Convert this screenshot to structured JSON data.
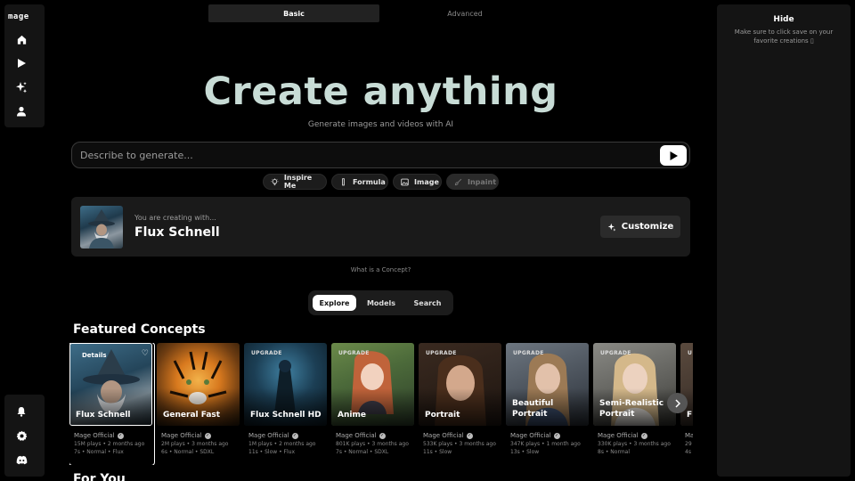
{
  "app": {
    "logo": "mage"
  },
  "nav": {
    "items": [
      {
        "icon": "home-icon"
      },
      {
        "icon": "play-icon"
      },
      {
        "icon": "sparkles-icon"
      },
      {
        "icon": "user-icon"
      }
    ],
    "bottom": [
      {
        "icon": "bell-icon"
      },
      {
        "icon": "gear-icon"
      },
      {
        "icon": "discord-icon"
      }
    ]
  },
  "mode_tabs": {
    "basic": "Basic",
    "advanced": "Advanced",
    "active": "Basic"
  },
  "hero": {
    "title": "Create anything",
    "subtitle": "Generate images and videos with AI"
  },
  "prompt": {
    "placeholder": "Describe to generate...",
    "value": ""
  },
  "chips": [
    {
      "label": "Inspire Me",
      "icon": "lightbulb-icon",
      "enabled": true
    },
    {
      "label": "Formula",
      "icon": "flask-icon",
      "enabled": true
    },
    {
      "label": "Image",
      "icon": "image-icon",
      "enabled": true
    },
    {
      "label": "Inpaint",
      "icon": "brush-icon",
      "enabled": false
    }
  ],
  "creating": {
    "label": "You are creating with...",
    "model": "Flux Schnell",
    "customize_label": "Customize"
  },
  "concept_link": "What is a Concept?",
  "explore_tabs": {
    "explore": "Explore",
    "models": "Models",
    "search": "Search",
    "active": "Explore"
  },
  "featured": {
    "title": "Featured Concepts",
    "cards": [
      {
        "title": "Flux Schnell",
        "badge": "",
        "details": "Details",
        "author": "Mage Official",
        "plays": "15M plays • 2 months ago",
        "info": "7s • Normal • Flux",
        "selected": true
      },
      {
        "title": "General Fast",
        "badge": "",
        "author": "Mage Official",
        "plays": "2M plays • 3 months ago",
        "info": "6s • Normal • SDXL",
        "selected": false
      },
      {
        "title": "Flux Schnell HD",
        "badge": "UPGRADE",
        "author": "Mage Official",
        "plays": "1M plays • 2 months ago",
        "info": "11s • Slow • Flux",
        "selected": false
      },
      {
        "title": "Anime",
        "badge": "UPGRADE",
        "author": "Mage Official",
        "plays": "801K plays • 3 months ago",
        "info": "7s • Normal • SDXL",
        "selected": false
      },
      {
        "title": "Portrait",
        "badge": "UPGRADE",
        "author": "Mage Official",
        "plays": "533K plays • 3 months ago",
        "info": "11s • Slow",
        "selected": false
      },
      {
        "title": "Beautiful Portrait",
        "badge": "UPGRADE",
        "author": "Mage Official",
        "plays": "347K plays • 1 month ago",
        "info": "13s • Slow",
        "selected": false
      },
      {
        "title": "Semi-Realistic Portrait",
        "badge": "UPGRADE",
        "author": "Mage Official",
        "plays": "330K plays • 3 months ago",
        "info": "8s • Normal",
        "selected": false
      },
      {
        "title": "F",
        "badge": "U",
        "author": "Ma",
        "plays": "29",
        "info": "4s",
        "selected": false
      }
    ]
  },
  "for_you": {
    "title": "For You"
  },
  "right_panel": {
    "hide_label": "Hide",
    "hint": "Make sure to click save on your favorite creations ▯"
  }
}
